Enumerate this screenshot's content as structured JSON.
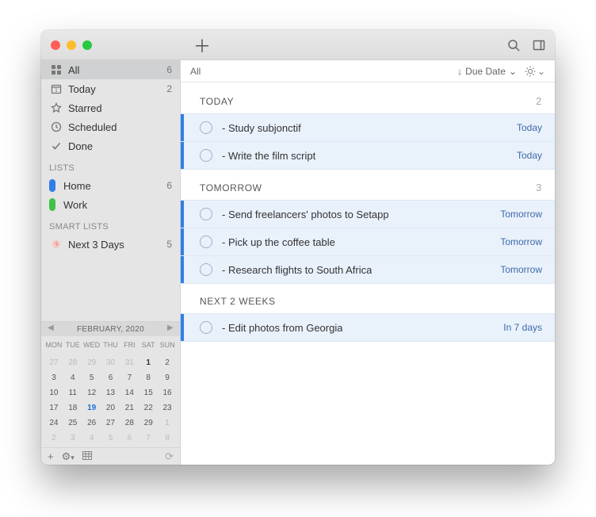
{
  "sidebar": {
    "views": [
      {
        "key": "all",
        "label": "All",
        "count": "6",
        "selected": true
      },
      {
        "key": "today",
        "label": "Today",
        "count": "2",
        "selected": false
      },
      {
        "key": "starred",
        "label": "Starred",
        "count": "",
        "selected": false
      },
      {
        "key": "scheduled",
        "label": "Scheduled",
        "count": "",
        "selected": false
      },
      {
        "key": "done",
        "label": "Done",
        "count": "",
        "selected": false
      }
    ],
    "lists_header": "LISTS",
    "lists": [
      {
        "label": "Home",
        "count": "6",
        "color": "#2f7fe6"
      },
      {
        "label": "Work",
        "count": "",
        "color": "#3fc24a"
      }
    ],
    "smart_header": "SMART LISTS",
    "smart": [
      {
        "label": "Next 3 Days",
        "count": "5"
      }
    ]
  },
  "calendar": {
    "title": "FEBRUARY, 2020",
    "dow": [
      "MON",
      "TUE",
      "WED",
      "THU",
      "FRI",
      "SAT",
      "SUN"
    ],
    "days": [
      {
        "n": "27",
        "dim": true
      },
      {
        "n": "28",
        "dim": true
      },
      {
        "n": "29",
        "dim": true
      },
      {
        "n": "30",
        "dim": true
      },
      {
        "n": "31",
        "dim": true
      },
      {
        "n": "1",
        "bold": true
      },
      {
        "n": "2"
      },
      {
        "n": "3"
      },
      {
        "n": "4"
      },
      {
        "n": "5"
      },
      {
        "n": "6"
      },
      {
        "n": "7"
      },
      {
        "n": "8"
      },
      {
        "n": "9"
      },
      {
        "n": "10"
      },
      {
        "n": "11"
      },
      {
        "n": "12"
      },
      {
        "n": "13"
      },
      {
        "n": "14"
      },
      {
        "n": "15"
      },
      {
        "n": "16"
      },
      {
        "n": "17"
      },
      {
        "n": "18"
      },
      {
        "n": "19",
        "today": true
      },
      {
        "n": "20"
      },
      {
        "n": "21"
      },
      {
        "n": "22"
      },
      {
        "n": "23"
      },
      {
        "n": "24"
      },
      {
        "n": "25"
      },
      {
        "n": "26"
      },
      {
        "n": "27"
      },
      {
        "n": "28"
      },
      {
        "n": "29"
      },
      {
        "n": "1",
        "dim": true
      },
      {
        "n": "2",
        "dim": true
      },
      {
        "n": "3",
        "dim": true
      },
      {
        "n": "4",
        "dim": true
      },
      {
        "n": "5",
        "dim": true
      },
      {
        "n": "6",
        "dim": true
      },
      {
        "n": "7",
        "dim": true
      },
      {
        "n": "8",
        "dim": true
      }
    ]
  },
  "filter": {
    "scope": "All",
    "sort_arrow": "↓",
    "sort_label": "Due Date",
    "sort_chevron": "⌄",
    "bright_chevron": "⌄"
  },
  "sections": [
    {
      "title": "TODAY",
      "count": "2",
      "tasks": [
        {
          "text": " - Study subjonctif",
          "due": "Today"
        },
        {
          "text": " - Write the film script",
          "due": "Today"
        }
      ]
    },
    {
      "title": "TOMORROW",
      "count": "3",
      "tasks": [
        {
          "text": " - Send freelancers' photos to Setapp",
          "due": "Tomorrow"
        },
        {
          "text": " - Pick up the coffee table",
          "due": "Tomorrow"
        },
        {
          "text": " - Research flights to South Africa",
          "due": "Tomorrow"
        }
      ]
    },
    {
      "title": "NEXT 2 WEEKS",
      "count": "",
      "tasks": [
        {
          "text": " - Edit photos from Georgia",
          "due": "In 7 days"
        }
      ]
    }
  ],
  "icons": {
    "plus": "＋",
    "gear": "⚙",
    "sync": "⟳",
    "add": "+",
    "today_num": "1"
  }
}
